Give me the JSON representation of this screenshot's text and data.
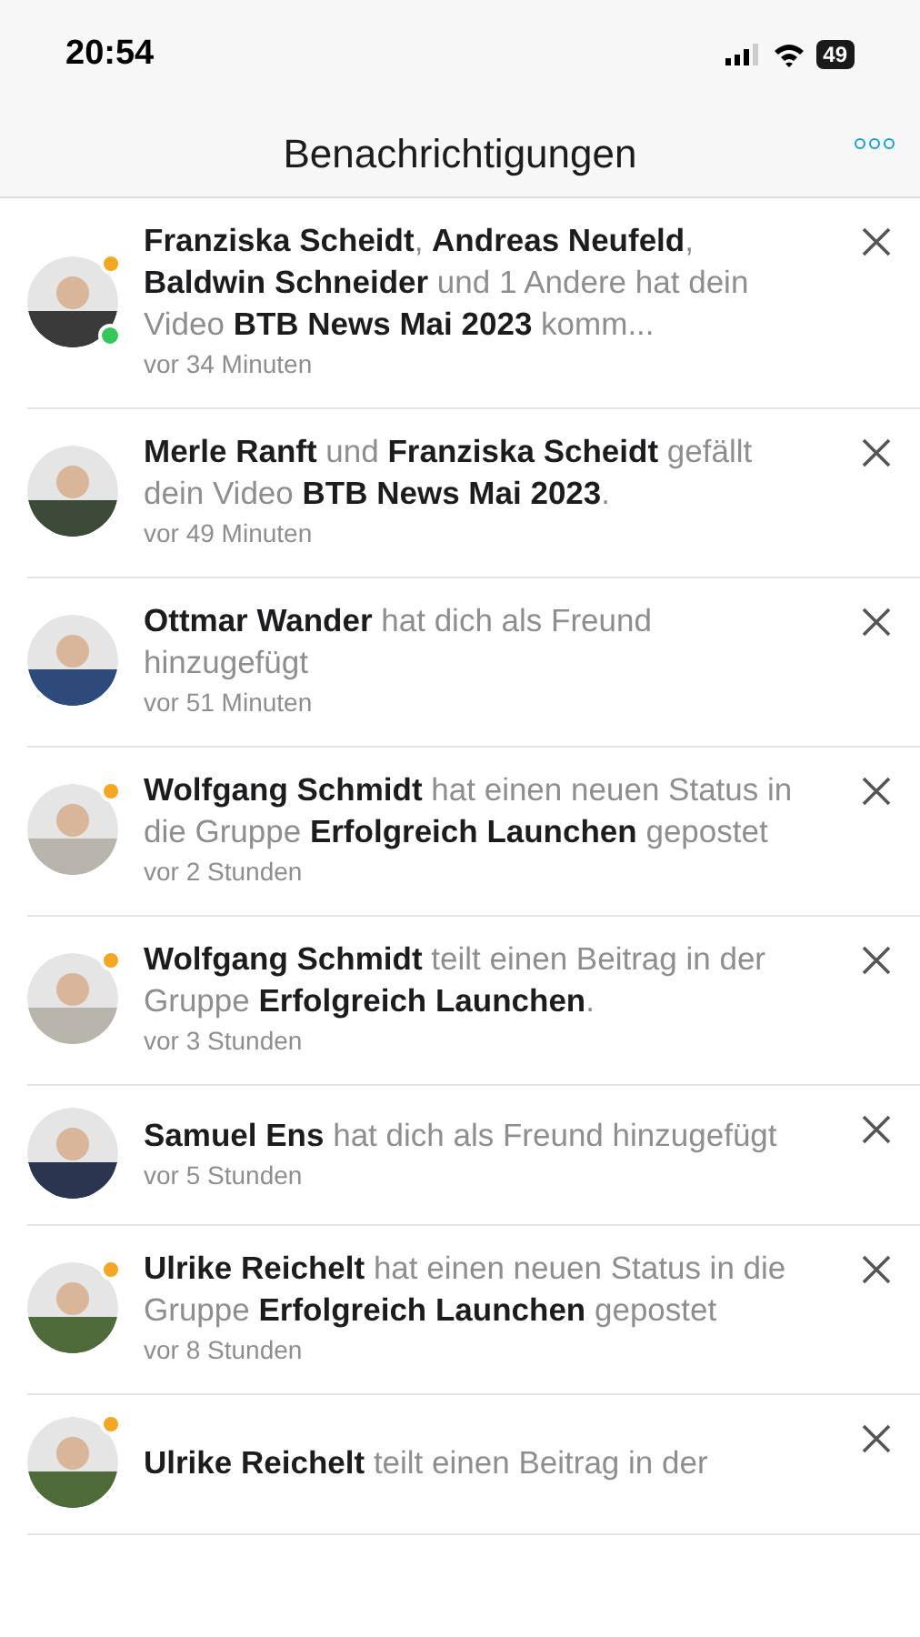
{
  "status_bar": {
    "time": "20:54",
    "battery": "49"
  },
  "header": {
    "title": "Benachrichtigungen"
  },
  "notifications": [
    {
      "text": "**Franziska Scheidt**, **Andreas Neufeld**, **Baldwin Schneider** und 1 Andere hat dein Video **BTB News Mai 2023** komm...",
      "time": "vor 34 Minuten",
      "badge": true,
      "online": true
    },
    {
      "text": "**Merle Ranft** und **Franziska Scheidt** gefällt dein Video **BTB News Mai 2023**.",
      "time": "vor 49 Minuten",
      "badge": false,
      "online": false
    },
    {
      "text": "**Ottmar Wander** hat dich als Freund hinzugefügt",
      "time": "vor 51 Minuten",
      "badge": false,
      "online": false
    },
    {
      "text": "**Wolfgang Schmidt** hat einen neuen Status in die Gruppe **Erfolgreich Launchen** gepostet",
      "time": "vor 2 Stunden",
      "badge": true,
      "online": false
    },
    {
      "text": "**Wolfgang Schmidt** teilt einen Beitrag in der Gruppe **Erfolgreich Launchen**.",
      "time": "vor 3 Stunden",
      "badge": true,
      "online": false
    },
    {
      "text": "**Samuel Ens** hat dich als Freund hinzugefügt",
      "time": "vor 5 Stunden",
      "badge": false,
      "online": false
    },
    {
      "text": "**Ulrike Reichelt** hat einen neuen Status in die Gruppe **Erfolgreich Launchen** gepostet",
      "time": "vor 8 Stunden",
      "badge": true,
      "online": false
    },
    {
      "text": "**Ulrike Reichelt** teilt einen Beitrag in der",
      "badge": true,
      "online": false
    }
  ]
}
